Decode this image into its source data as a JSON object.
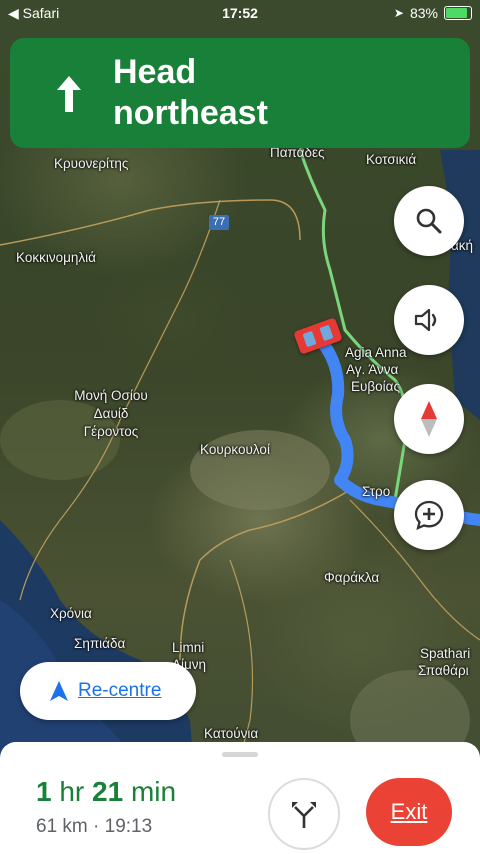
{
  "status_bar": {
    "back_app": "◀ Safari",
    "time": "17:52",
    "battery": "83%"
  },
  "navigation": {
    "instruction_line1": "Head",
    "instruction_line2": "northeast",
    "direction_icon": "arrow-up-icon"
  },
  "map": {
    "road_marker": "77",
    "labels": {
      "papades": "Παπάδες",
      "kotsikia": "Κοτσικιά",
      "kryoneritis": "Κρυονερίτης",
      "kokkinomilia": "Κοκκινομηλιά",
      "agia_anna_latin": "Agia Anna",
      "agia_anna_greek": "Αγ. Άννα",
      "evoias": "Ευβοίας",
      "moni_line1": "Μονή Οσίου",
      "moni_line2": "Δαυίδ",
      "moni_line3": "Γέροντος",
      "kourkouloi": "Κουρκουλοί",
      "strofylia": "Στρο",
      "farakla": "Φαράκλα",
      "chronia": "Χρόνια",
      "spiada": "Σηπιάδα",
      "limni_latin": "Limni",
      "limni_greek": "Λίμνη",
      "spathari_latin": "Spathari",
      "spathari_greek": "Σπαθάρι",
      "katounia": "Κατούνια",
      "edge_k": "ακή"
    },
    "buttons": [
      "search-icon",
      "volume-icon",
      "compass-icon",
      "add-comment-icon"
    ]
  },
  "recentre": {
    "label": "Re-centre"
  },
  "trip": {
    "eta_hours": "1",
    "eta_hr_unit": "hr",
    "eta_minutes": "21",
    "eta_min_unit": "min",
    "distance_time": "61 km · 19:13",
    "exit_label": "Exit"
  },
  "colors": {
    "banner": "#188038",
    "route": "#4285f4",
    "exit": "#ea4335",
    "eta": "#188038"
  }
}
